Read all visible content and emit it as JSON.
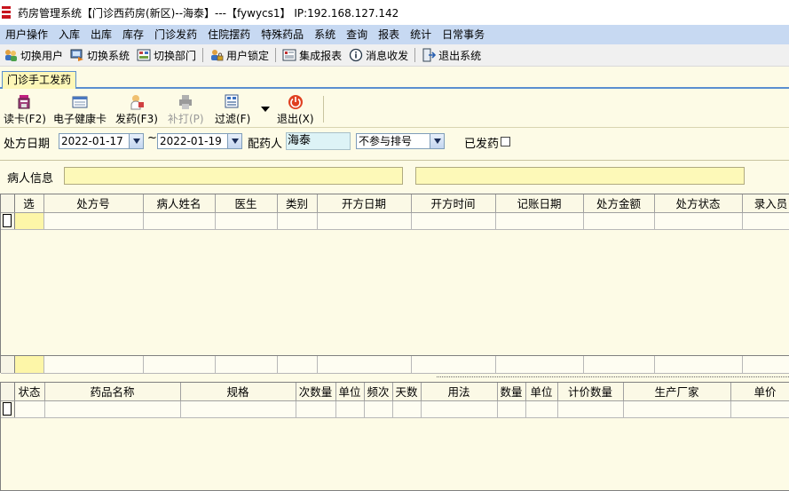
{
  "window": {
    "title": "药房管理系统【门诊西药房(新区)--海泰】---【fywycs1】 IP:192.168.127.142"
  },
  "menu": [
    "用户操作",
    "入库",
    "出库",
    "库存",
    "门诊发药",
    "住院摆药",
    "特殊药品",
    "系统",
    "查询",
    "报表",
    "统计",
    "日常事务"
  ],
  "toolbar": {
    "items": [
      {
        "label": "切换用户",
        "icon": "switch-user-icon"
      },
      {
        "label": "切换系统",
        "icon": "switch-system-icon"
      },
      {
        "label": "切换部门",
        "icon": "switch-department-icon"
      },
      {
        "label": "用户锁定",
        "icon": "user-lock-icon"
      },
      {
        "label": "集成报表",
        "icon": "integrated-report-icon"
      },
      {
        "label": "消息收发",
        "icon": "message-icon"
      },
      {
        "label": "退出系统",
        "icon": "exit-system-icon"
      }
    ]
  },
  "tab": {
    "label": "门诊手工发药"
  },
  "actions": {
    "read_card": "读卡(F2)",
    "health_card": "电子健康卡",
    "dispense": "发药(F3)",
    "reprint": "补打(P)",
    "filter": "过滤(F)",
    "exit": "退出(X)"
  },
  "filters": {
    "date_label": "处方日期",
    "date_from": "2022-01-17",
    "tilde": "~",
    "date_to": "2022-01-19",
    "pharmacist_label": "配药人",
    "pharmacist_value": "海泰",
    "queue_option": "不参与排号",
    "dispensed_label": "已发药",
    "dispensed_checked": false
  },
  "patient": {
    "label": "病人信息",
    "info": "",
    "info2": ""
  },
  "prescription_table": {
    "columns": [
      "选",
      "处方号",
      "病人姓名",
      "医生",
      "类别",
      "开方日期",
      "开方时间",
      "记账日期",
      "处方金额",
      "处方状态",
      "录入员"
    ]
  },
  "drug_table": {
    "columns": [
      "状态",
      "药品名称",
      "规格",
      "次数量",
      "单位",
      "频次",
      "天数",
      "用法",
      "数量",
      "单位",
      "计价数量",
      "生产厂家",
      "单价"
    ]
  },
  "colors": {
    "menubar_bg": "#c7d9f2",
    "panel_bg": "#fdfbe6",
    "patient_input_bg": "#fdf9b8",
    "pharmacist_input_bg": "#ddf3f6",
    "tab_border": "#5a8fd0"
  }
}
